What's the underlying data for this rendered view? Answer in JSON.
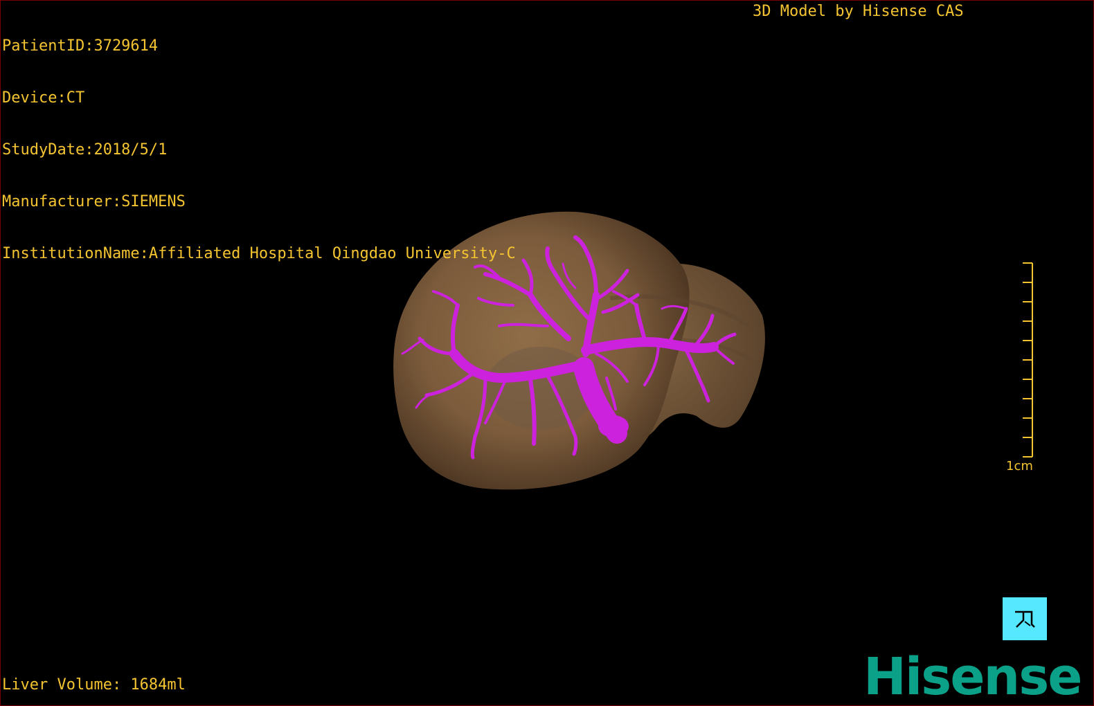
{
  "patient_info": {
    "patient_id": "PatientID:3729614",
    "device": "Device:CT",
    "study_date": "StudyDate:2018/5/1",
    "manufacturer": "Manufacturer:SIEMENS",
    "institution": "InstitutionName:Affiliated Hospital Qingdao University-C"
  },
  "brand_label": "3D Model by Hisense CAS",
  "volume_label": "Liver Volume: 1684ml",
  "scale": {
    "label": "1cm"
  },
  "logo_text": "Hisense",
  "colors": {
    "overlay_text": "#f5c531",
    "liver": "#7a5c3c",
    "vessels": "#cc22dd",
    "orientation_cube": "#56e8ff",
    "logo": "#0aa188",
    "frame_border": "#7a0000"
  },
  "icons": {
    "orientation_cube": "orientation-cube-icon",
    "scale_bar": "scale-bar-icon"
  }
}
